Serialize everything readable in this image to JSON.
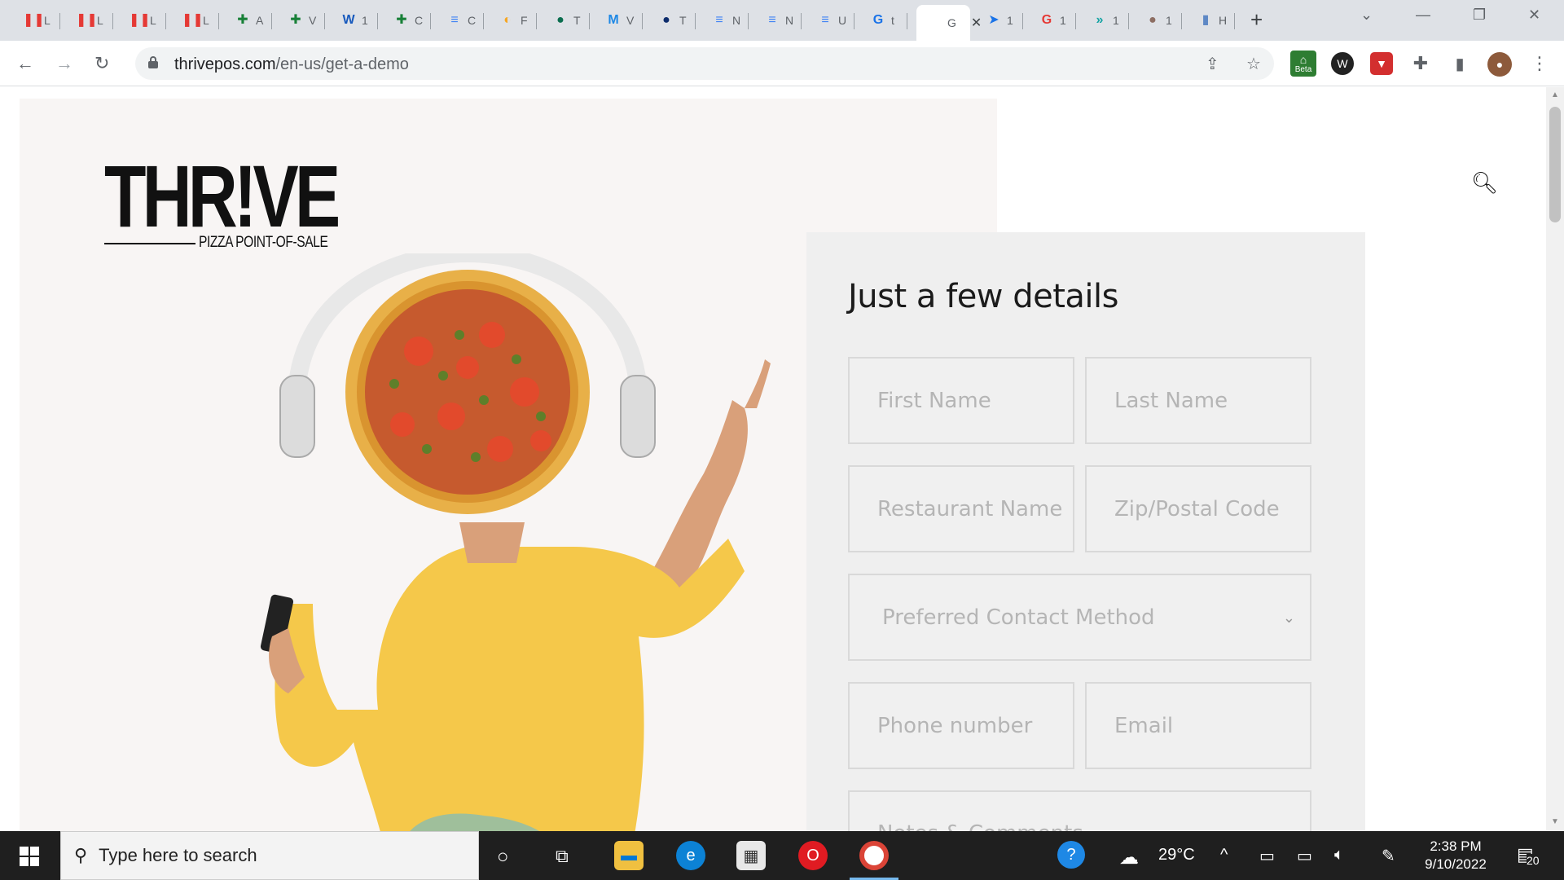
{
  "browser": {
    "tabs": [
      {
        "letter": "L",
        "color": "#e53935",
        "glyph": "❚❚"
      },
      {
        "letter": "L",
        "color": "#e53935",
        "glyph": "❚❚"
      },
      {
        "letter": "L",
        "color": "#e53935",
        "glyph": "❚❚"
      },
      {
        "letter": "L",
        "color": "#e53935",
        "glyph": "❚❚"
      },
      {
        "letter": "A",
        "color": "#188038",
        "glyph": "✚"
      },
      {
        "letter": "V",
        "color": "#188038",
        "glyph": "✚"
      },
      {
        "letter": "1",
        "color": "#185abd",
        "glyph": "W"
      },
      {
        "letter": "C",
        "color": "#188038",
        "glyph": "✚"
      },
      {
        "letter": "C",
        "color": "#4285f4",
        "glyph": "≡"
      },
      {
        "letter": "F",
        "color": "#f6a623",
        "glyph": "◐"
      },
      {
        "letter": "T",
        "color": "#0b6e4f",
        "glyph": "●"
      },
      {
        "letter": "V",
        "color": "#1e88e5",
        "glyph": "M"
      },
      {
        "letter": "T",
        "color": "#0d2c6c",
        "glyph": "●"
      },
      {
        "letter": "N",
        "color": "#4285f4",
        "glyph": "≡"
      },
      {
        "letter": "N",
        "color": "#4285f4",
        "glyph": "≡"
      },
      {
        "letter": "U",
        "color": "#4285f4",
        "glyph": "≡"
      },
      {
        "letter": "t",
        "color": "#ffffff",
        "glyph": "G"
      },
      {
        "letter": "G",
        "color": "#ffffff",
        "glyph": "",
        "active": true
      },
      {
        "letter": "1",
        "color": "#ffffff",
        "glyph": "➤"
      },
      {
        "letter": "1",
        "color": "#e53935",
        "glyph": "G"
      },
      {
        "letter": "1",
        "color": "#14a3a3",
        "glyph": "»"
      },
      {
        "letter": "1",
        "color": "#8d6e63",
        "glyph": "●"
      },
      {
        "letter": "H",
        "color": "#5e88c5",
        "glyph": "▮"
      }
    ],
    "close_tab_glyph": "✕",
    "new_tab_glyph": "+",
    "url_host": "thrivepos.com",
    "url_path": "/en-us/get-a-demo",
    "ext_beta_label": "Beta"
  },
  "page": {
    "brand": {
      "wordmark": "THR!VE",
      "tagline": "PIZZA POINT-OF-SALE"
    },
    "form": {
      "title": "Just a few details",
      "first_name_placeholder": "First Name",
      "last_name_placeholder": "Last Name",
      "restaurant_placeholder": "Restaurant Name",
      "zip_placeholder": "Zip/Postal Code",
      "contact_method_placeholder": "Preferred Contact Method",
      "phone_placeholder": "Phone number",
      "email_placeholder": "Email",
      "notes_placeholder": "Notes & Comments"
    }
  },
  "taskbar": {
    "search_placeholder": "Type here to search",
    "temperature": "29°C",
    "time": "2:38 PM",
    "date": "9/10/2022",
    "notification_count": "20"
  },
  "colors": {
    "hero_bg": "#f8f5f4",
    "form_bg": "#efefef",
    "sweater": "#f5c84a",
    "pants": "#9fbf9b"
  }
}
